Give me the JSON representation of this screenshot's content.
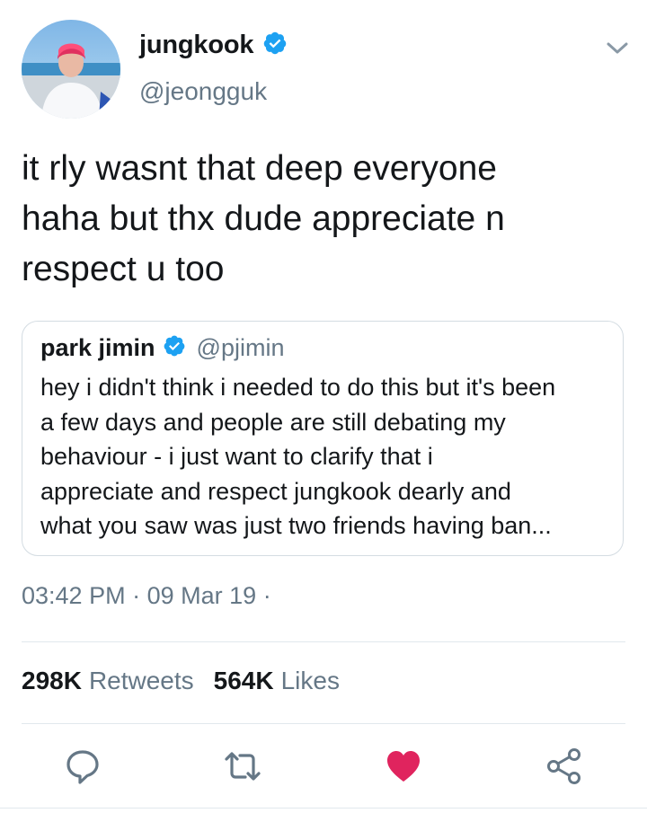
{
  "author": {
    "display_name": "jungkook",
    "handle": "@jeongguk",
    "verified": true
  },
  "tweet": {
    "lines": [
      "it rly wasnt that deep everyone",
      "haha but thx dude appreciate n",
      "respect u too"
    ]
  },
  "quoted_tweet": {
    "display_name": "park jimin",
    "handle": "@pjimin",
    "verified": true,
    "lines": [
      "hey i didn't think i needed to do this but it's been",
      "a few days and people are still debating my",
      "behaviour - i just want to clarify that i",
      "appreciate and respect jungkook dearly and",
      "what you saw was just two friends having ban..."
    ]
  },
  "meta": {
    "time": "03:42 PM",
    "date": "09 Mar 19",
    "separator": "·"
  },
  "stats": {
    "retweets_count": "298K",
    "retweets_label": "Retweets",
    "likes_count": "564K",
    "likes_label": "Likes"
  },
  "actions": [
    {
      "name": "reply-icon"
    },
    {
      "name": "retweet-icon"
    },
    {
      "name": "like-icon",
      "active": true
    },
    {
      "name": "share-icon"
    }
  ],
  "colors": {
    "verified": "#1da1f2",
    "like_active": "#e0245e",
    "secondary_text": "#657786",
    "action_icon": "#657786"
  }
}
